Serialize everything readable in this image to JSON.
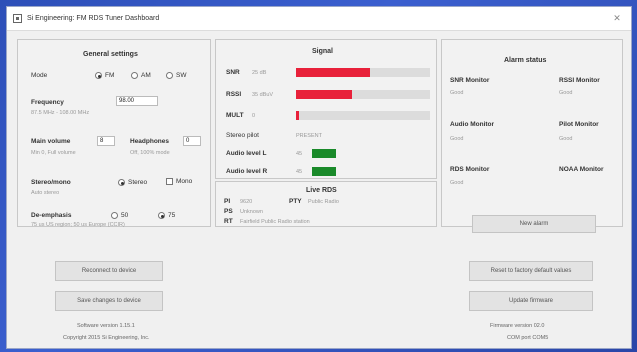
{
  "window": {
    "title": "Si Engineering: FM RDS Tuner Dashboard"
  },
  "general": {
    "title": "General settings",
    "mode_label": "Mode",
    "mode_options": [
      "FM",
      "AM",
      "SW"
    ],
    "frequency_label": "Frequency",
    "frequency_value": "98.00",
    "frequency_sub": "87.5 MHz - 108.00 MHz",
    "main_volume_label": "Main volume",
    "main_volume_value": "8",
    "main_volume_sub": "Min 0, Full volume",
    "headphones_label": "Headphones",
    "headphones_value": "0",
    "headphones_sub": "Off, 100% mode",
    "stereo_label": "Stereo/mono",
    "stereo_options": [
      "Stereo",
      "Mono"
    ],
    "stereo_sub": "Auto stereo",
    "deemph_label": "De-emphasis",
    "deemph_options": [
      "50",
      "75"
    ],
    "deemph_sub": "75 us US region; 50 us Europe (CCIR)"
  },
  "signal": {
    "title": "Signal",
    "rows": [
      {
        "label": "SNR",
        "value": "25 dB",
        "fill": 0.55,
        "color": "#e8213a"
      },
      {
        "label": "RSSI",
        "value": "35 dBuV",
        "fill": 0.42,
        "color": "#e8213a"
      },
      {
        "label": "MULT",
        "value": "0",
        "fill": 0.02,
        "color": "#e8213a"
      }
    ],
    "stereo_pilot_label": "Stereo pilot",
    "stereo_pilot_value": "PRESENT",
    "audio_left_label": "Audio level L",
    "audio_left_value": "45",
    "audio_left_fill": 0.2,
    "audio_right_label": "Audio level R",
    "audio_right_value": "45",
    "audio_right_fill": 0.2,
    "audio_color": "#1a8a2a"
  },
  "rds": {
    "title": "Live RDS",
    "pi_label": "PI",
    "pi_value": "9620",
    "pty_label": "PTY",
    "pty_value": "Public Radio",
    "ps_label": "PS",
    "ps_value": "Unknown",
    "rt_label": "RT",
    "rt_value": "Fairfield Public Radio station"
  },
  "alarm": {
    "title": "Alarm status",
    "snr_label": "SNR Monitor",
    "snr_value": "Good",
    "rssi_label": "RSSI Monitor",
    "rssi_value": "Good",
    "audio_label": "Audio Monitor",
    "audio_value": "Good",
    "pilot_label": "Pilot Monitor",
    "pilot_value": "Good",
    "rds_label": "RDS Monitor",
    "rds_value": "Good",
    "noaa_label": "NOAA Monitor",
    "noaa_value": "",
    "button": "New alarm"
  },
  "buttons": {
    "reconnect": "Reconnect to device",
    "save": "Save changes to device",
    "reset": "Reset to factory default values",
    "update": "Update firmware"
  },
  "footer": {
    "software_version": "Software version 1.15.1",
    "copyright": "Copyright 2015 Si Engineering, Inc.",
    "firmware_version": "Firmware version 02.0",
    "chip": "COM port COM5"
  }
}
